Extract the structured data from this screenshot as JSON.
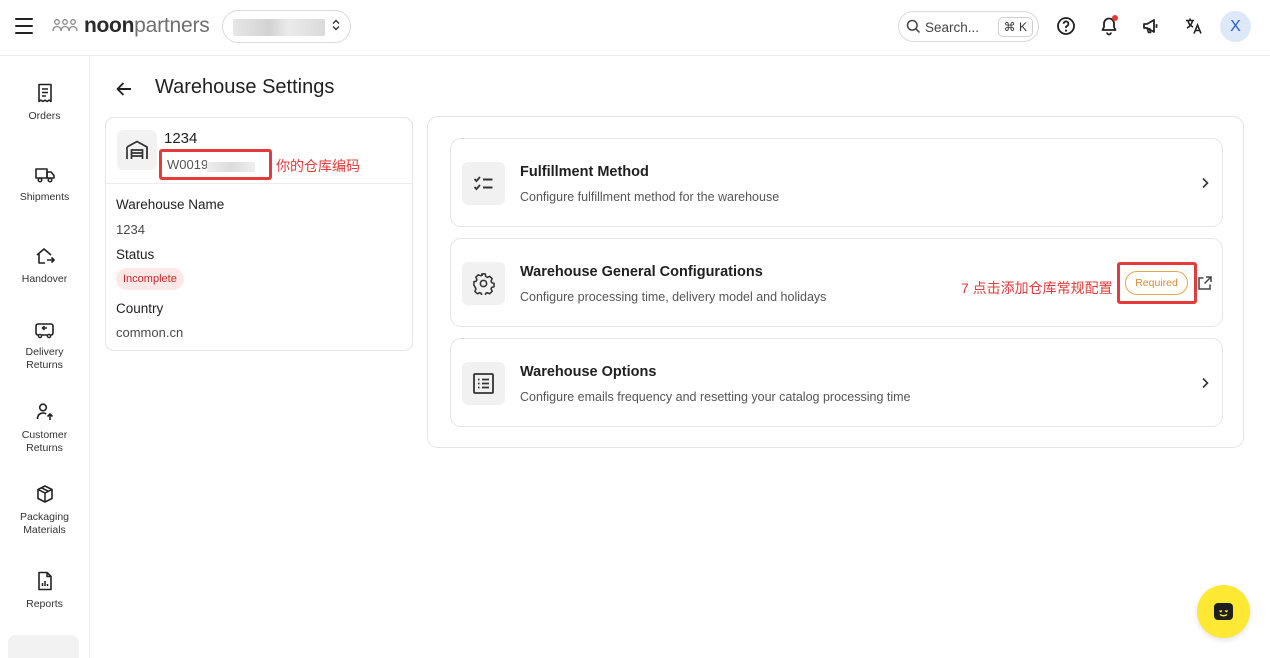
{
  "header": {
    "logo_bold": "noon",
    "logo_light": "partners",
    "search_placeholder": "Search...",
    "search_shortcut": "⌘ K",
    "avatar_initial": "X"
  },
  "sidebar": {
    "items": [
      {
        "label": "Orders",
        "icon": "receipt-icon"
      },
      {
        "label": "Shipments",
        "icon": "truck-icon"
      },
      {
        "label": "Handover",
        "icon": "home-arrow-icon"
      },
      {
        "label": "Delivery\nReturns",
        "icon": "truck-return-icon"
      },
      {
        "label": "Customer\nReturns",
        "icon": "user-return-icon"
      },
      {
        "label": "Packaging\nMaterials",
        "icon": "package-icon"
      },
      {
        "label": "Reports",
        "icon": "report-icon"
      }
    ]
  },
  "page": {
    "title": "Warehouse Settings"
  },
  "warehouse": {
    "name": "1234",
    "code": "W0019",
    "code_annotation": "你的仓库编码",
    "fields": {
      "name_label": "Warehouse Name",
      "name_value": "1234",
      "status_label": "Status",
      "status_value": "Incomplete",
      "country_label": "Country",
      "country_value": "common.cn"
    }
  },
  "settings": [
    {
      "title": "Fulfillment Method",
      "description": "Configure fulfillment method for the warehouse",
      "icon": "checklist-icon"
    },
    {
      "title": "Warehouse General Configurations",
      "description": "Configure processing time, delivery model and holidays",
      "icon": "gear-icon",
      "badge": "Required",
      "annotation": "7 点击添加仓库常规配置"
    },
    {
      "title": "Warehouse Options",
      "description": "Configure emails frequency and resetting your catalog processing time",
      "icon": "list-icon"
    }
  ],
  "colors": {
    "annotation_red": "#e53a3a",
    "status_incomplete_bg": "#fde7e7",
    "status_incomplete_text": "#c62828",
    "required_orange": "#e0892c",
    "chat_yellow": "#fde934",
    "avatar_blue": "#2a5bd7"
  }
}
